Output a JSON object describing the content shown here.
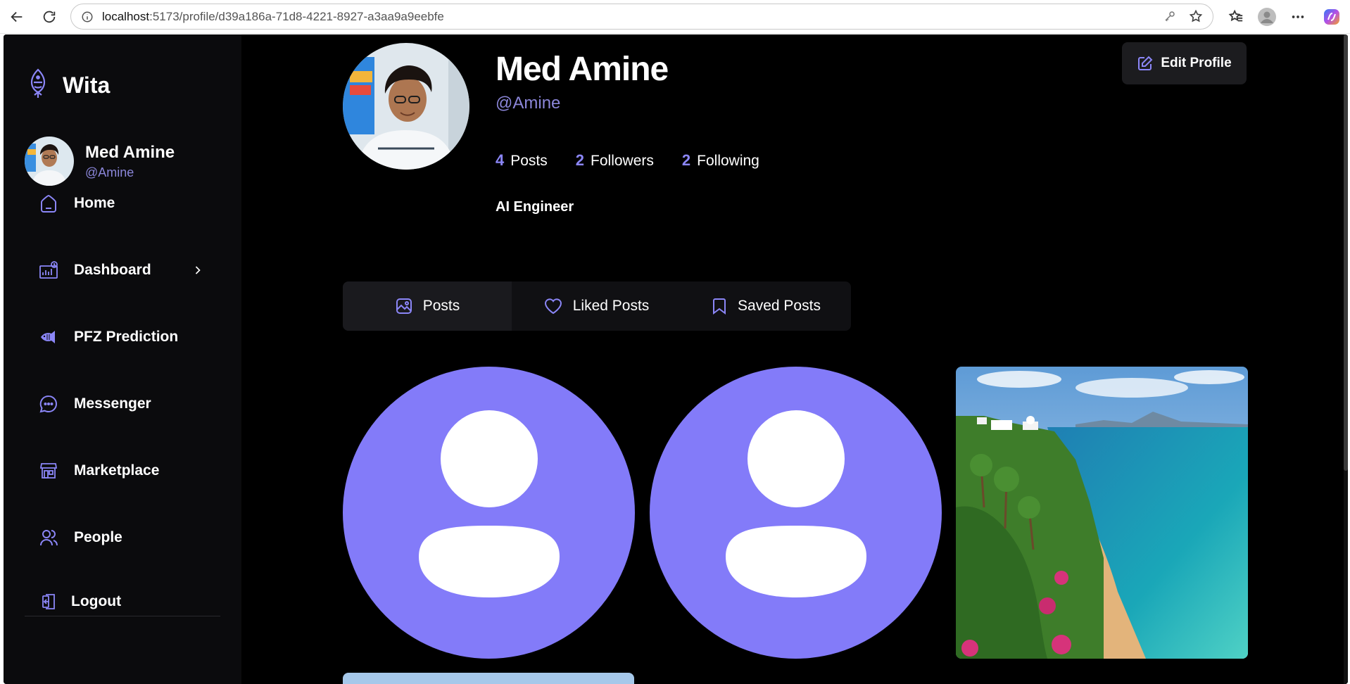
{
  "browser": {
    "url_host": "localhost",
    "url_path": ":5173/profile/d39a186a-71d8-4221-8927-a3aa9a9eebfe"
  },
  "brand": {
    "name": "Wita"
  },
  "current_user": {
    "name": "Med Amine",
    "handle": "@Amine"
  },
  "sidebar": {
    "items": [
      {
        "label": "Home",
        "icon": "home-icon"
      },
      {
        "label": "Dashboard",
        "icon": "dashboard-icon"
      },
      {
        "label": "PFZ Prediction",
        "icon": "fish-icon"
      },
      {
        "label": "Messenger",
        "icon": "chat-bubble-icon"
      },
      {
        "label": "Marketplace",
        "icon": "store-icon"
      },
      {
        "label": "People",
        "icon": "people-icon"
      }
    ],
    "logout_label": "Logout"
  },
  "profile": {
    "name": "Med Amine",
    "handle": "@Amine",
    "bio": "AI Engineer",
    "stats": [
      {
        "count": "4",
        "label": "Posts"
      },
      {
        "count": "2",
        "label": "Followers"
      },
      {
        "count": "2",
        "label": "Following"
      }
    ],
    "edit_label": "Edit Profile"
  },
  "tabs": [
    {
      "label": "Posts",
      "icon": "image-icon",
      "active": true
    },
    {
      "label": "Liked Posts",
      "icon": "heart-icon",
      "active": false
    },
    {
      "label": "Saved Posts",
      "icon": "bookmark-icon",
      "active": false
    }
  ],
  "colors": {
    "accent": "#837bf9",
    "handle": "#8b86d9",
    "background": "#000000",
    "sidebar": "#0b0b0d"
  }
}
